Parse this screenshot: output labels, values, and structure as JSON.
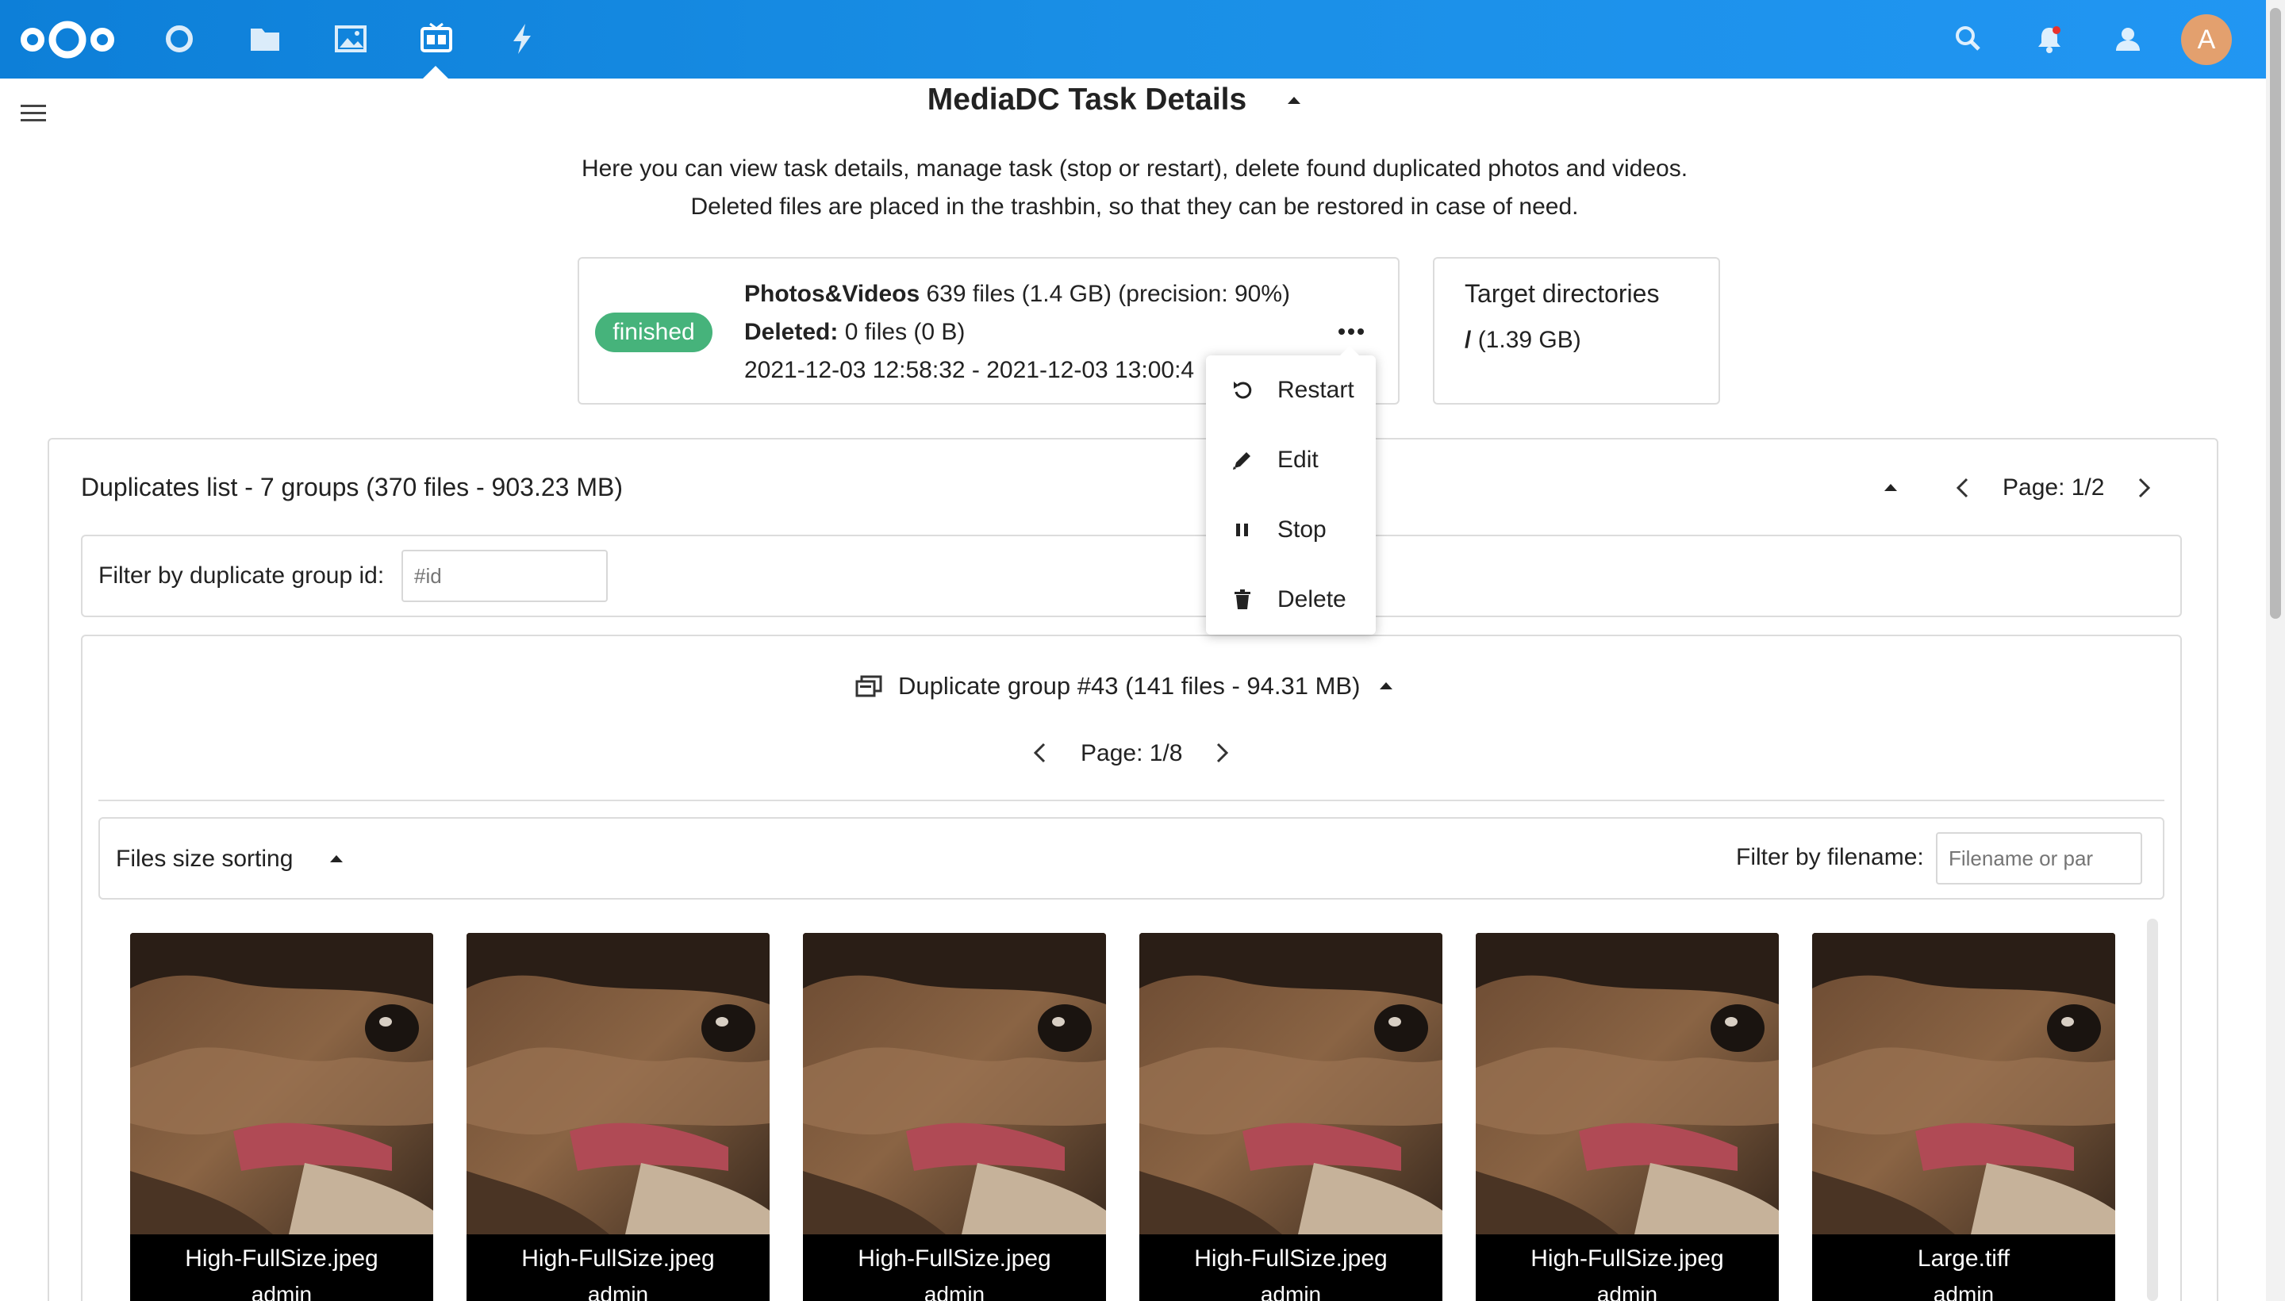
{
  "header": {
    "nav_icons": [
      "nextcloud-logo",
      "dashboard-icon",
      "files-icon",
      "photos-icon",
      "mediadc-icon",
      "activity-icon"
    ],
    "right_icons": [
      "search-icon",
      "notifications-icon",
      "contacts-icon"
    ],
    "avatar_letter": "A",
    "colors": {
      "header": "#1a8fe6",
      "status_finished": "#46b37b",
      "avatar": "#e3a06e"
    }
  },
  "page": {
    "title": "MediaDC Task Details",
    "description_line1": "Here you can view task details, manage task (stop or restart), delete found duplicated photos and videos.",
    "description_line2": "Deleted files are placed in the trashbin, so that they can be restored in case of need."
  },
  "task": {
    "status": "finished",
    "type_label": "Photos&Videos",
    "type_detail": "639 files (1.4 GB) (precision: 90%)",
    "deleted_label": "Deleted:",
    "deleted_detail": "0 files (0 B)",
    "time_range": "2021-12-03 12:58:32 - 2021-12-03 13:00:4"
  },
  "target": {
    "title": "Target directories",
    "path": "/",
    "size": "(1.39 GB)"
  },
  "menu": {
    "items": [
      {
        "label": "Restart",
        "icon": "restart-icon"
      },
      {
        "label": "Edit",
        "icon": "pencil-icon"
      },
      {
        "label": "Stop",
        "icon": "pause-icon"
      },
      {
        "label": "Delete",
        "icon": "trash-icon"
      }
    ]
  },
  "duplicates": {
    "title": "Duplicates list - 7 groups (370 files - 903.23 MB)",
    "page": "Page: 1/2",
    "filter_label": "Filter by duplicate group id:",
    "filter_placeholder": "#id",
    "group": {
      "title": "Duplicate group #43 (141 files - 94.31 MB)",
      "page": "Page: 1/8",
      "sort_label": "Files size sorting",
      "filename_filter_label": "Filter by filename:",
      "filename_filter_placeholder": "Filename or par",
      "files": [
        {
          "name": "High-FullSize.jpeg",
          "owner": "admin"
        },
        {
          "name": "High-FullSize.jpeg",
          "owner": "admin"
        },
        {
          "name": "High-FullSize.jpeg",
          "owner": "admin"
        },
        {
          "name": "High-FullSize.jpeg",
          "owner": "admin"
        },
        {
          "name": "High-FullSize.jpeg",
          "owner": "admin"
        },
        {
          "name": "Large.tiff",
          "owner": "admin"
        }
      ]
    }
  }
}
